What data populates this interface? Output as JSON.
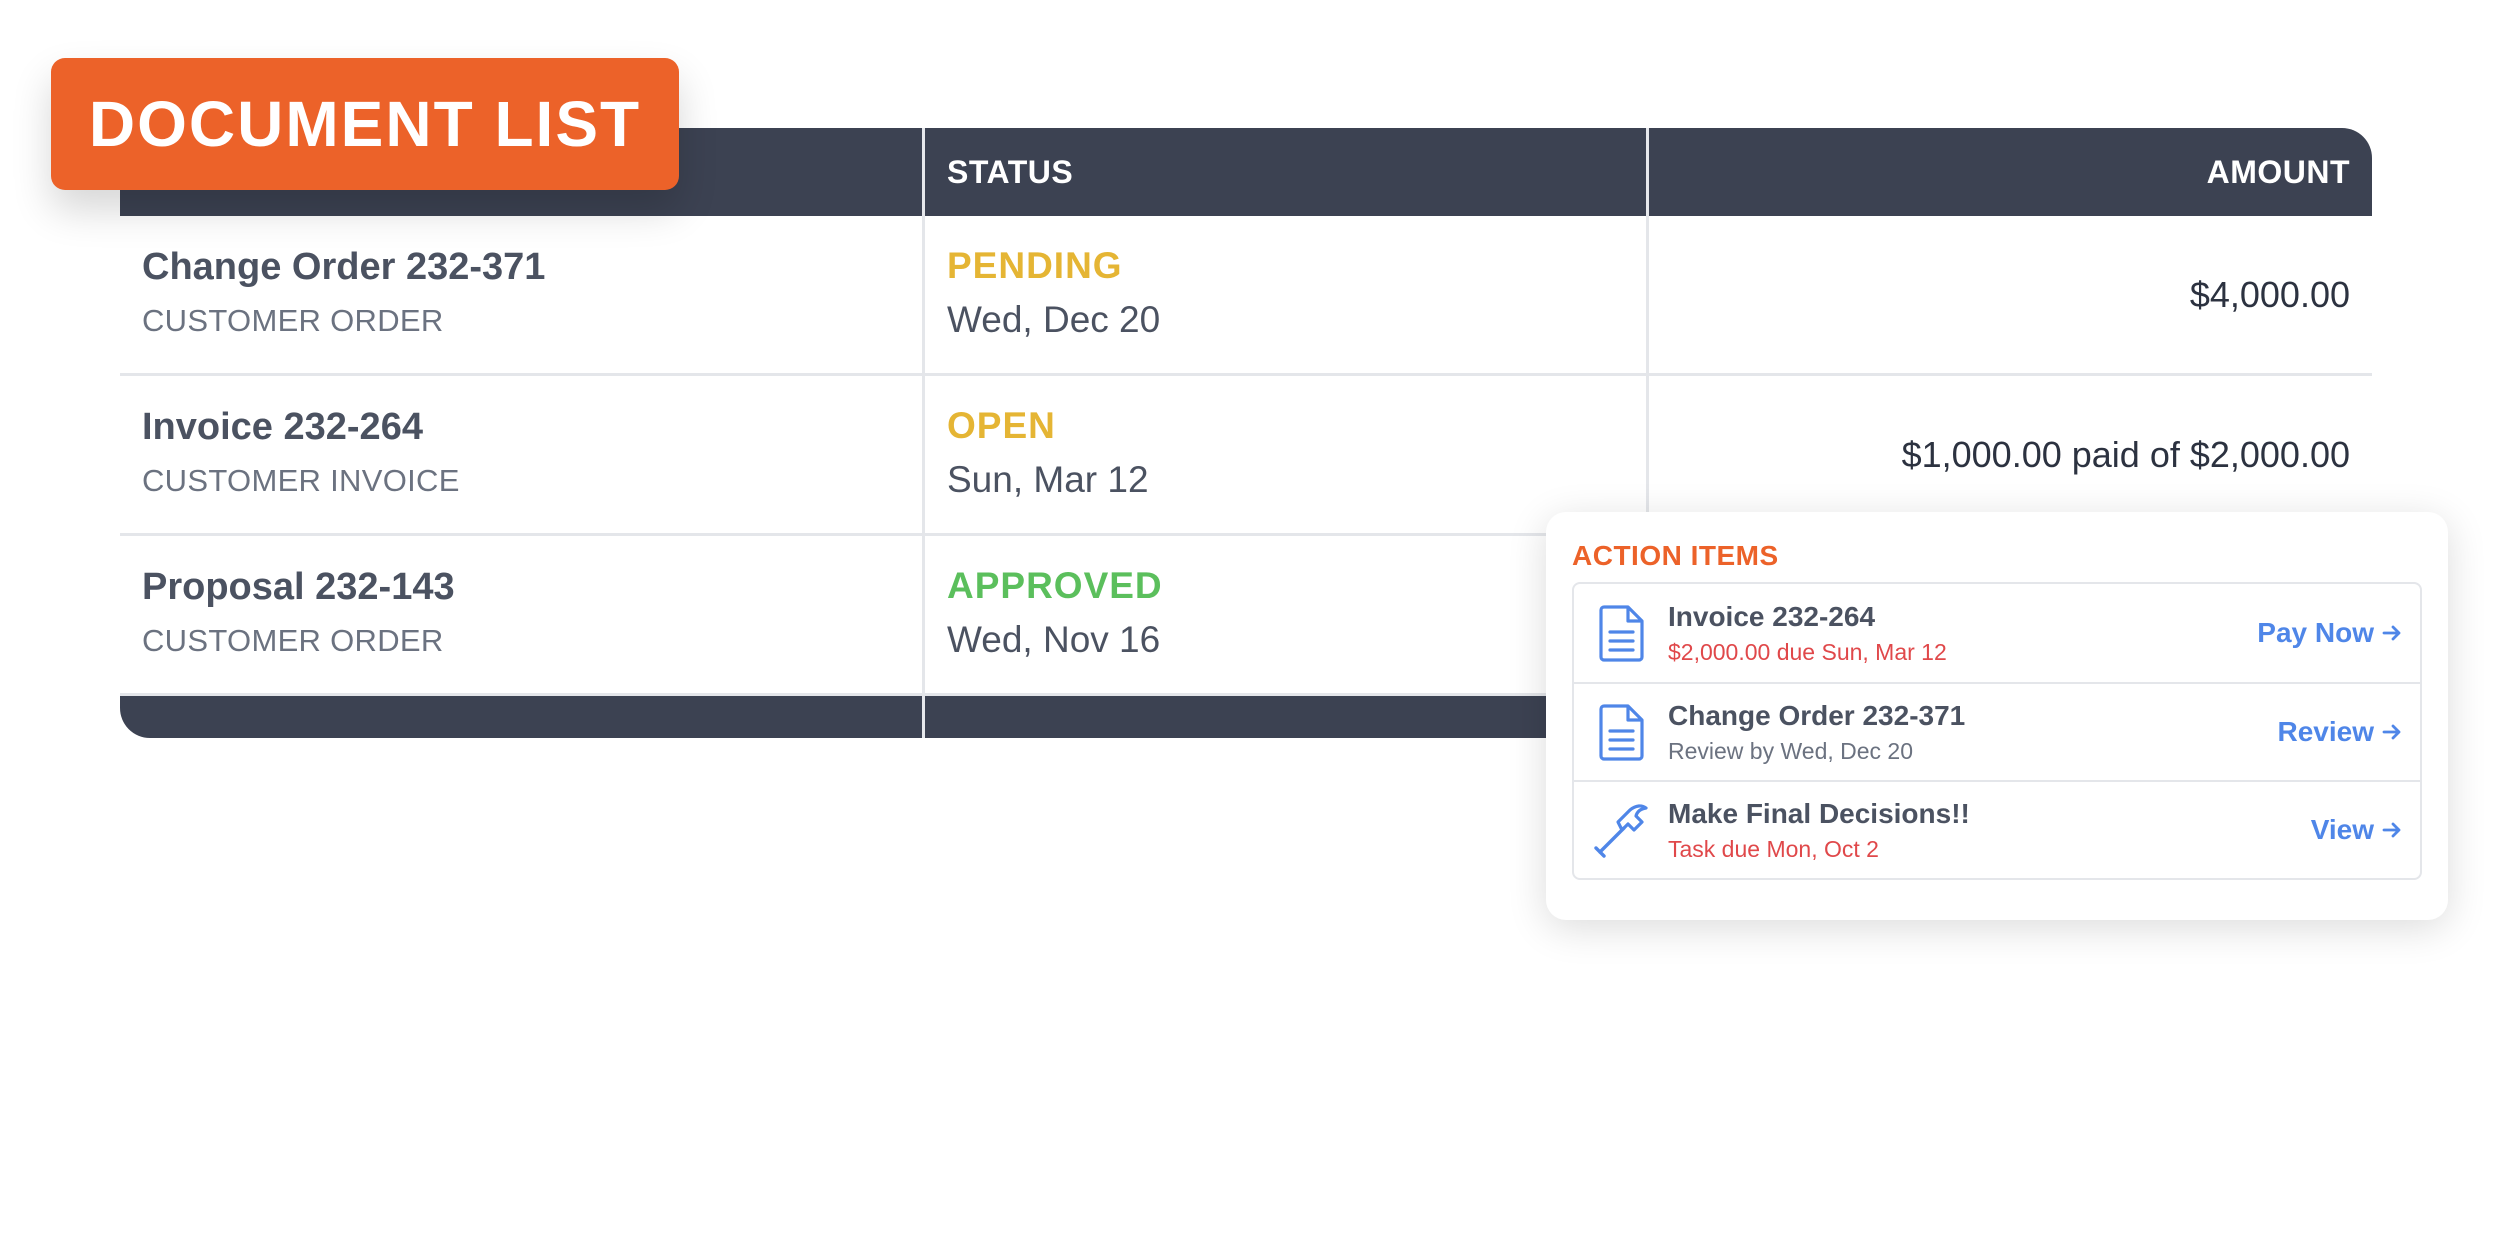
{
  "badge": {
    "label": "DOCUMENT LIST"
  },
  "table": {
    "columns": [
      "",
      "STATUS",
      "AMOUNT"
    ],
    "rows": [
      {
        "title": "Change Order 232-371",
        "type": "CUSTOMER ORDER",
        "status": "PENDING",
        "date": "Wed, Dec 20",
        "amount": "$4,000.00"
      },
      {
        "title": "Invoice 232-264",
        "type": "CUSTOMER INVOICE",
        "status": "OPEN",
        "date": "Sun, Mar 12",
        "amount": "$1,000.00 paid of $2,000.00"
      },
      {
        "title": "Proposal 232-143",
        "type": "CUSTOMER ORDER",
        "status": "APPROVED",
        "date": "Wed, Nov 16",
        "amount": ""
      }
    ]
  },
  "action_items": {
    "title": "ACTION ITEMS",
    "items": [
      {
        "icon": "document-icon",
        "title": "Invoice 232-264",
        "subtitle": "$2,000.00 due  Sun, Mar 12",
        "action": "Pay Now"
      },
      {
        "icon": "document-icon",
        "title": "Change Order 232-371",
        "subtitle": "Review by Wed, Dec 20",
        "action": "Review"
      },
      {
        "icon": "hammer-icon",
        "title": "Make Final Decisions!!",
        "subtitle": "Task due Mon, Oct 2",
        "action": "View"
      }
    ]
  },
  "colors": {
    "header": "#3c4252",
    "accent": "#ec6229",
    "pending": "#e5b534",
    "approved": "#5bbf5c",
    "link": "#4f86e8",
    "due": "#e0484a"
  }
}
